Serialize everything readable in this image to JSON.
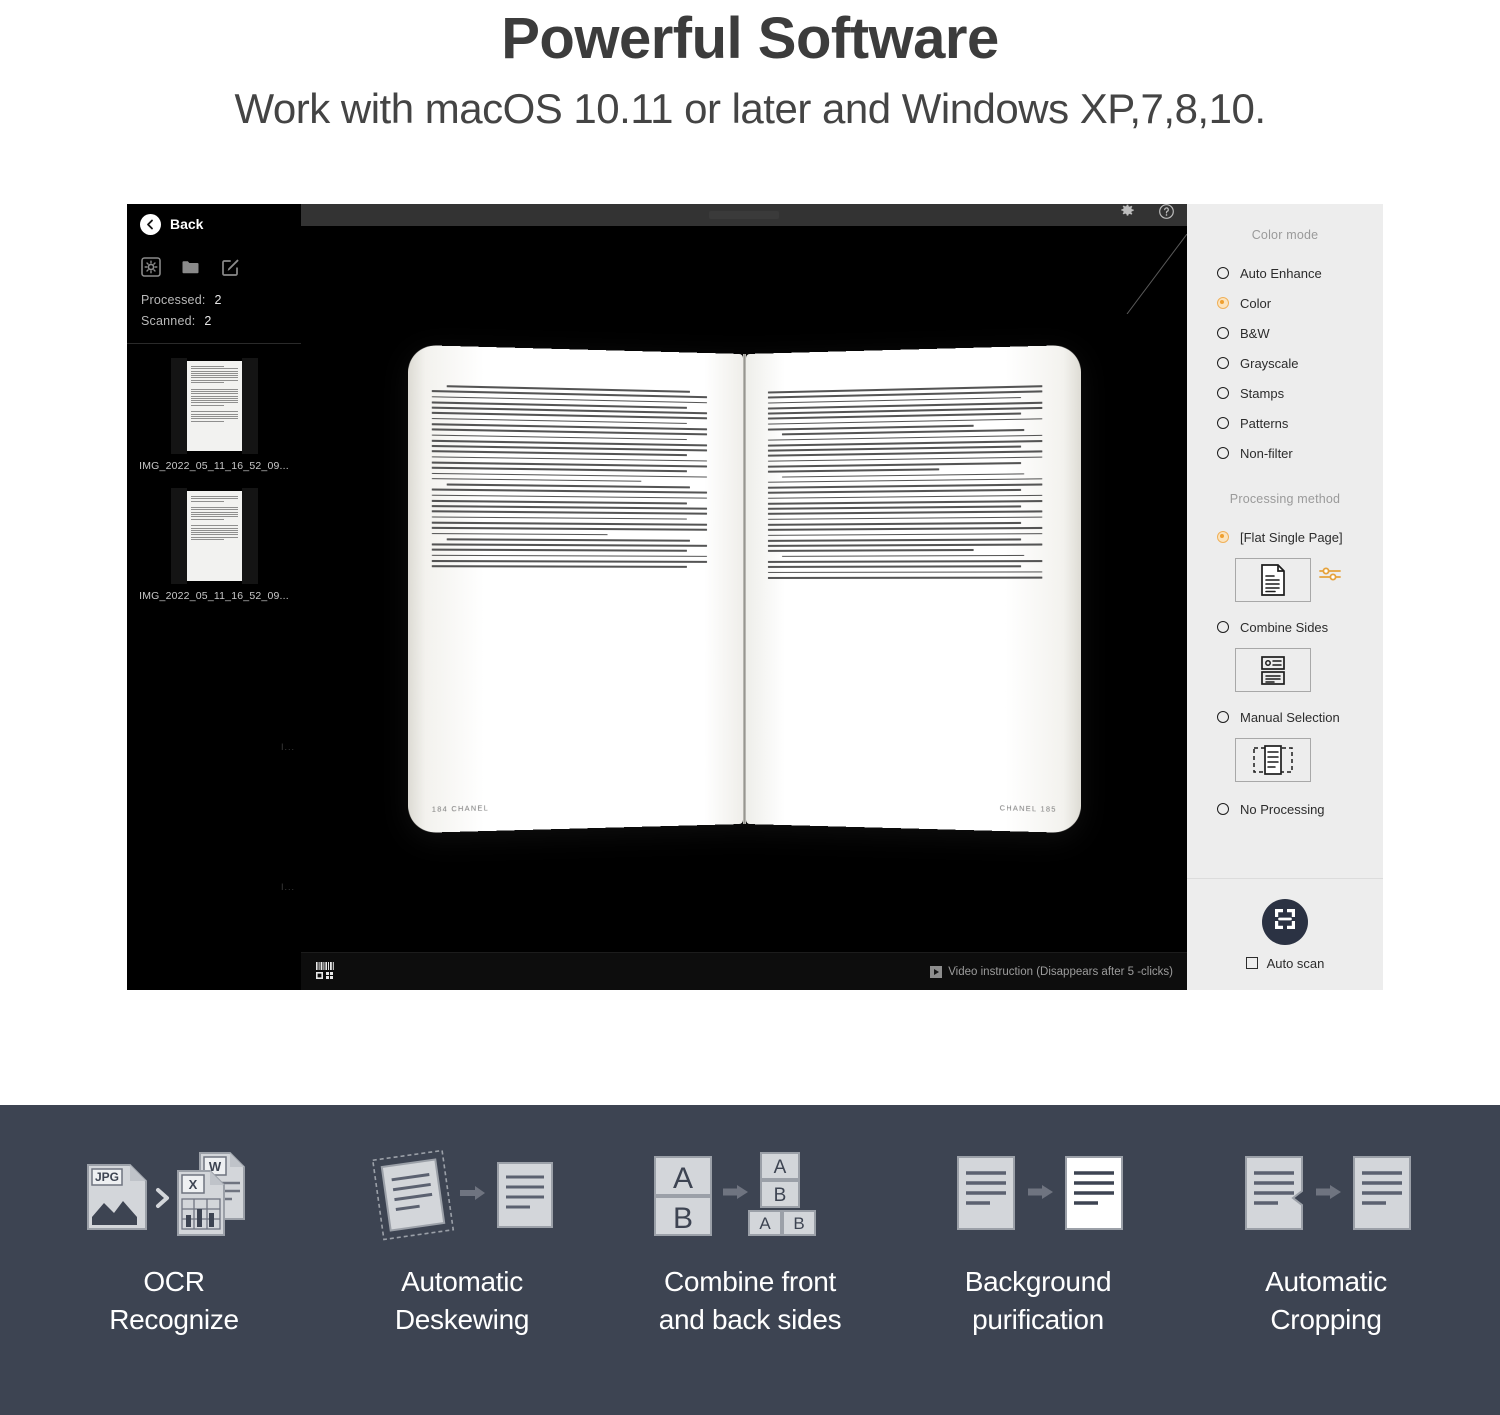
{
  "header": {
    "title": "Powerful Software",
    "subtitle": "Work with macOS 10.11 or later and Windows XP,7,8,10."
  },
  "app": {
    "back_label": "Back",
    "toolbar_icons": [
      "settings-box-icon",
      "folder-icon",
      "edit-box-icon"
    ],
    "titlebar_icons": [
      "gear-icon",
      "help-icon"
    ],
    "stats": [
      {
        "label": "Processed:",
        "value": "2"
      },
      {
        "label": "Scanned:",
        "value": "2"
      }
    ],
    "thumbnails": [
      {
        "name": "IMG_2022_05_11_16_52_09..."
      },
      {
        "name": "IMG_2022_05_11_16_52_09..."
      }
    ],
    "edge_marks": [
      "I...",
      "I..."
    ],
    "preview": {
      "page_left_footer": "184  CHANEL",
      "page_right_footer": "CHANEL   185",
      "barcode_icon": "barcode-qr-icon",
      "video_hint": "Video instruction (Disappears after 5 -clicks)"
    },
    "right_panel": {
      "color_mode_title": "Color mode",
      "color_modes": [
        {
          "label": "Auto Enhance",
          "selected": false
        },
        {
          "label": "Color",
          "selected": true
        },
        {
          "label": "B&W",
          "selected": false
        },
        {
          "label": "Grayscale",
          "selected": false
        },
        {
          "label": "Stamps",
          "selected": false
        },
        {
          "label": "Patterns",
          "selected": false
        },
        {
          "label": "Non-filter",
          "selected": false
        }
      ],
      "processing_title": "Processing method",
      "processing_methods": [
        {
          "label": "[Flat Single Page]",
          "selected": true,
          "icon": "single-page-icon"
        },
        {
          "label": "Combine Sides",
          "selected": false,
          "icon": "combine-sides-icon"
        },
        {
          "label": "Manual Selection",
          "selected": false,
          "icon": "manual-selection-icon"
        },
        {
          "label": "No Processing",
          "selected": false,
          "icon": null
        }
      ],
      "scan_button_icon": "scan-frame-icon",
      "auto_scan_label": "Auto scan",
      "auto_scan_checked": false
    }
  },
  "features": [
    {
      "caption_line1": "OCR",
      "caption_line2": "Recognize",
      "icon": "ocr-convert-icon"
    },
    {
      "caption_line1": "Automatic",
      "caption_line2": "Deskewing",
      "icon": "deskew-icon"
    },
    {
      "caption_line1": "Combine front",
      "caption_line2": "and back sides",
      "icon": "combine-front-back-icon"
    },
    {
      "caption_line1": "Background",
      "caption_line2": "purification",
      "icon": "background-purify-icon"
    },
    {
      "caption_line1": "Automatic",
      "caption_line2": "Cropping",
      "icon": "auto-crop-icon"
    }
  ],
  "colors": {
    "accent_orange": "#ef9f2f",
    "panel_bg": "#ededed",
    "footer_bg": "#3d4452",
    "scan_button": "#2b3243"
  }
}
